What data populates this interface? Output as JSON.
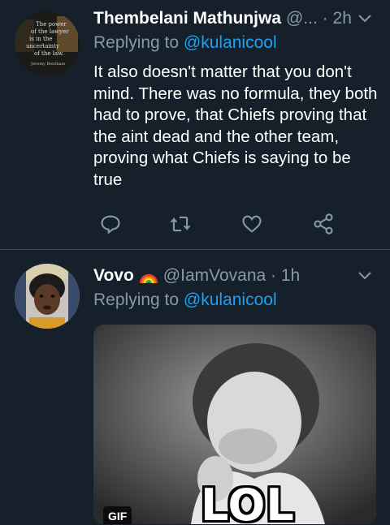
{
  "tweets": [
    {
      "author_name": "Thembelani Mathunjwa",
      "handle_time": "@... · 2h",
      "replying_prefix": "Replying to ",
      "replying_to": "@kulanicool",
      "text": "It also doesn't matter that you don't mind. There was no formula, they both had to prove, that Chiefs proving that the aint dead and the other team, proving what Chiefs is saying to be true",
      "avatar_text": "The power of the lawyer is in the uncertainty of the law. Jeremy Bentham",
      "actions": [
        "reply-icon",
        "retweet-icon",
        "like-icon",
        "share-icon"
      ]
    },
    {
      "author_name": "Vovo",
      "emoji": "rainbow-icon",
      "handle_time": "@IamVovana · 1h",
      "replying_prefix": "Replying to ",
      "replying_to": "@kulanicool",
      "media": {
        "type": "gif",
        "badge": "GIF",
        "caption": "LOL"
      }
    }
  ],
  "colors": {
    "background": "#15202b",
    "divider": "#38444d",
    "secondary_text": "#8899a6",
    "link": "#1da1f2"
  }
}
